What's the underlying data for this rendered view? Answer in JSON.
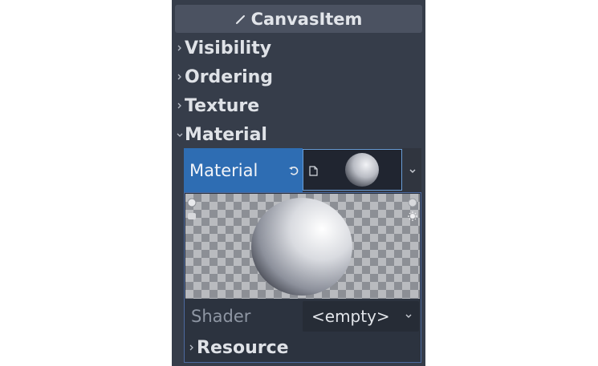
{
  "inspector": {
    "header": {
      "title": "CanvasItem",
      "icon": "pencil-icon"
    },
    "sections": [
      {
        "label": "Visibility",
        "expanded": false
      },
      {
        "label": "Ordering",
        "expanded": false
      },
      {
        "label": "Texture",
        "expanded": false
      },
      {
        "label": "Material",
        "expanded": true
      }
    ],
    "material_property": {
      "label": "Material",
      "revert_icon": "revert-icon",
      "resource_icon": "file-icon",
      "dropdown_icon": "chevron-down-icon"
    },
    "material_editor": {
      "shader_label": "Shader",
      "shader_value": "<empty>",
      "resource_label": "Resource"
    }
  },
  "colors": {
    "panel_bg": "#363d4a",
    "header_bg": "#4b5261",
    "selected_property": "#2e6db3",
    "picker_border": "#6a9ed6",
    "text": "#dfe2e7",
    "muted_text": "#8e96a3"
  }
}
